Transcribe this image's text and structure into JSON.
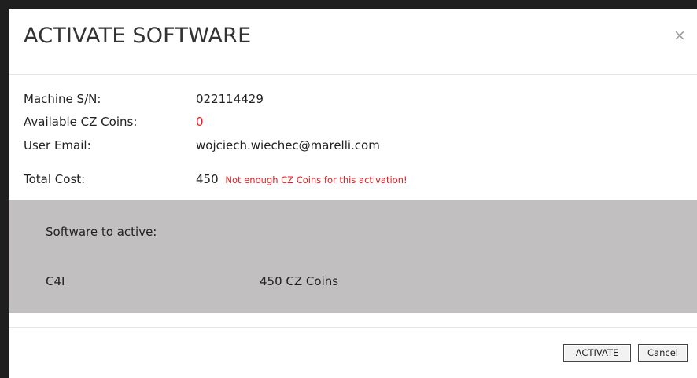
{
  "dialog": {
    "title": "ACTIVATE SOFTWARE",
    "close_glyph": "×"
  },
  "info": {
    "machine_sn_label": "Machine S/N:",
    "machine_sn_value": "022114429",
    "coins_label": "Available CZ Coins:",
    "coins_value": "0",
    "email_label": "User Email:",
    "email_value": "wojciech.wiechec@marelli.com",
    "total_cost_label": "Total Cost:",
    "total_cost_value": "450",
    "warning_text": "Not enough CZ Coins for this activation!"
  },
  "software": {
    "heading": "Software to active:",
    "items": [
      {
        "name": "C4I",
        "price": "450 CZ Coins"
      }
    ]
  },
  "footer": {
    "activate_label": "ACTIVATE",
    "cancel_label": "Cancel"
  },
  "colors": {
    "accent_red": "#e8191f",
    "panel_gray": "#c1bfbf",
    "backdrop": "#1f1f1f"
  },
  "icons": {
    "close": "close-icon"
  }
}
